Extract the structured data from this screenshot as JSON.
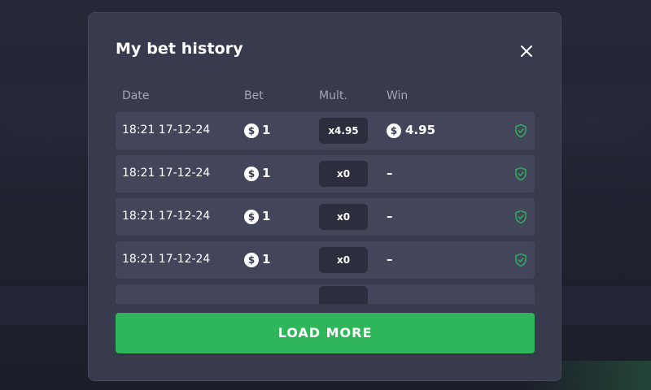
{
  "modal": {
    "title": "My bet history",
    "close_icon": "close-icon",
    "columns": {
      "date": "Date",
      "bet": "Bet",
      "mult": "Mult.",
      "win": "Win"
    },
    "rows": [
      {
        "date": "18:21 17-12-24",
        "currency_icon": "$",
        "bet": "1",
        "mult": "x4.95",
        "win_currency_icon": "$",
        "win": "4.95",
        "dash": "",
        "verified_icon": "shield-check-icon"
      },
      {
        "date": "18:21 17-12-24",
        "currency_icon": "$",
        "bet": "1",
        "mult": "x0",
        "win_currency_icon": "",
        "win": "",
        "dash": "–",
        "verified_icon": "shield-check-icon"
      },
      {
        "date": "18:21 17-12-24",
        "currency_icon": "$",
        "bet": "1",
        "mult": "x0",
        "win_currency_icon": "",
        "win": "",
        "dash": "–",
        "verified_icon": "shield-check-icon"
      },
      {
        "date": "18:21 17-12-24",
        "currency_icon": "$",
        "bet": "1",
        "mult": "x0",
        "win_currency_icon": "",
        "win": "",
        "dash": "–",
        "verified_icon": "shield-check-icon"
      }
    ],
    "load_more_label": "LOAD MORE"
  },
  "colors": {
    "modal_bg": "#383a4d",
    "row_bg": "#43455a",
    "pill_bg": "#2c2e3e",
    "accent_green": "#2fb65a",
    "shield_green": "#2fb65a",
    "header_text": "#a4a6b7"
  }
}
